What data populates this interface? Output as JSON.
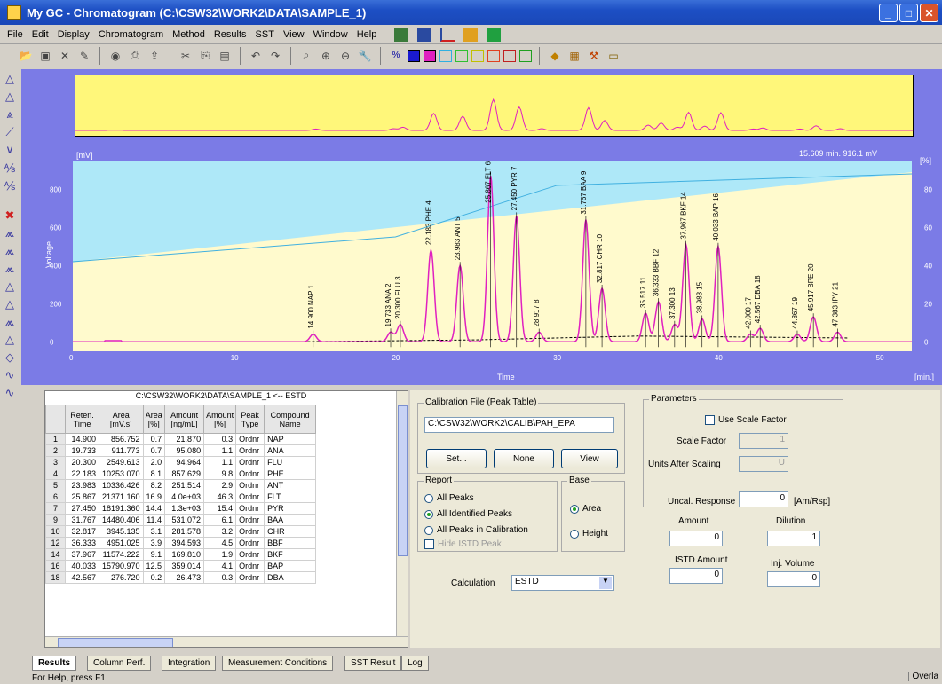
{
  "window": {
    "title": "My GC - Chromatogram (C:\\CSW32\\WORK2\\DATA\\SAMPLE_1)"
  },
  "menu": [
    "File",
    "Edit",
    "Display",
    "Chromatogram",
    "Method",
    "Results",
    "SST",
    "View",
    "Window",
    "Help"
  ],
  "chart": {
    "readout": "15.609 min. 916.1 mV",
    "y_label_units": "[mV]",
    "y_axis_title": "Voltage",
    "y_right_units": "[%]",
    "x_units": "[min.]",
    "x_title": "Time",
    "y_ticks": [
      "0",
      "200",
      "400",
      "600",
      "800"
    ],
    "y_right_ticks": [
      "0",
      "20",
      "40",
      "60",
      "80"
    ],
    "x_ticks": [
      "0",
      "10",
      "20",
      "30",
      "40",
      "50"
    ],
    "peak_labels": [
      {
        "text": "14.900 NAP 1",
        "t": 14.9
      },
      {
        "text": "19.733 ANA 2",
        "t": 19.7
      },
      {
        "text": "20.300 FLU 3",
        "t": 20.3
      },
      {
        "text": "22.183 PHE 4",
        "t": 22.2
      },
      {
        "text": "23.983 ANT 5",
        "t": 24.0
      },
      {
        "text": "25.867 FLT 6",
        "t": 25.9
      },
      {
        "text": "27.450 PYR 7",
        "t": 27.5
      },
      {
        "text": "28.917 8",
        "t": 28.9
      },
      {
        "text": "31.767 BAA 9",
        "t": 31.8
      },
      {
        "text": "32.817 CHR 10",
        "t": 32.8
      },
      {
        "text": "35.517 11",
        "t": 35.5
      },
      {
        "text": "36.333 BBF 12",
        "t": 36.3
      },
      {
        "text": "37.300 13",
        "t": 37.3
      },
      {
        "text": "37.967 BKF 14",
        "t": 38.0
      },
      {
        "text": "38.983 15",
        "t": 39.0
      },
      {
        "text": "40.033 BAP 16",
        "t": 40.0
      },
      {
        "text": "42.000 17",
        "t": 42.0
      },
      {
        "text": "42.567 DBA 18",
        "t": 42.6
      },
      {
        "text": "44.867 19",
        "t": 44.9
      },
      {
        "text": "45.917 BPE 20",
        "t": 45.9
      },
      {
        "text": "47.383 IPY 21",
        "t": 47.4
      }
    ]
  },
  "chart_data": {
    "type": "line",
    "xlabel": "Time",
    "ylabel": "Voltage",
    "xlim": [
      0,
      52
    ],
    "ylim": [
      -50,
      950
    ],
    "peaks": [
      {
        "t": 14.9,
        "h": 40
      },
      {
        "t": 19.7,
        "h": 50
      },
      {
        "t": 20.3,
        "h": 90
      },
      {
        "t": 22.2,
        "h": 480
      },
      {
        "t": 24.0,
        "h": 400
      },
      {
        "t": 25.9,
        "h": 870
      },
      {
        "t": 27.5,
        "h": 660
      },
      {
        "t": 28.9,
        "h": 50
      },
      {
        "t": 31.8,
        "h": 640
      },
      {
        "t": 32.8,
        "h": 280
      },
      {
        "t": 35.5,
        "h": 150
      },
      {
        "t": 36.3,
        "h": 210
      },
      {
        "t": 37.3,
        "h": 90
      },
      {
        "t": 38.0,
        "h": 510
      },
      {
        "t": 39.0,
        "h": 120
      },
      {
        "t": 40.0,
        "h": 500
      },
      {
        "t": 42.0,
        "h": 40
      },
      {
        "t": 42.6,
        "h": 70
      },
      {
        "t": 44.9,
        "h": 40
      },
      {
        "t": 45.9,
        "h": 130
      },
      {
        "t": 47.4,
        "h": 50
      }
    ]
  },
  "table": {
    "path": "C:\\CSW32\\WORK2\\DATA\\SAMPLE_1 <-- ESTD",
    "headers": [
      "",
      "Reten. Time",
      "Area [mV.s]",
      "Area [%]",
      "Amount [ng/mL]",
      "Amount [%]",
      "Peak Type",
      "Compound Name"
    ],
    "rows": [
      [
        "1",
        "14.900",
        "856.752",
        "0.7",
        "21.870",
        "0.3",
        "Ordnr",
        "NAP"
      ],
      [
        "2",
        "19.733",
        "911.773",
        "0.7",
        "95.080",
        "1.1",
        "Ordnr",
        "ANA"
      ],
      [
        "3",
        "20.300",
        "2549.613",
        "2.0",
        "94.964",
        "1.1",
        "Ordnr",
        "FLU"
      ],
      [
        "4",
        "22.183",
        "10253.070",
        "8.1",
        "857.629",
        "9.8",
        "Ordnr",
        "PHE"
      ],
      [
        "5",
        "23.983",
        "10336.426",
        "8.2",
        "251.514",
        "2.9",
        "Ordnr",
        "ANT"
      ],
      [
        "6",
        "25.867",
        "21371.160",
        "16.9",
        "4.0e+03",
        "46.3",
        "Ordnr",
        "FLT"
      ],
      [
        "7",
        "27.450",
        "18191.360",
        "14.4",
        "1.3e+03",
        "15.4",
        "Ordnr",
        "PYR"
      ],
      [
        "9",
        "31.767",
        "14480.406",
        "11.4",
        "531.072",
        "6.1",
        "Ordnr",
        "BAA"
      ],
      [
        "10",
        "32.817",
        "3945.135",
        "3.1",
        "281.578",
        "3.2",
        "Ordnr",
        "CHR"
      ],
      [
        "12",
        "36.333",
        "4951.025",
        "3.9",
        "394.593",
        "4.5",
        "Ordnr",
        "BBF"
      ],
      [
        "14",
        "37.967",
        "11574.222",
        "9.1",
        "169.810",
        "1.9",
        "Ordnr",
        "BKF"
      ],
      [
        "16",
        "40.033",
        "15790.970",
        "12.5",
        "359.014",
        "4.1",
        "Ordnr",
        "BAP"
      ],
      [
        "18",
        "42.567",
        "276.720",
        "0.2",
        "26.473",
        "0.3",
        "Ordnr",
        "DBA"
      ]
    ]
  },
  "calibration": {
    "group": "Calibration File (Peak Table)",
    "file": "C:\\CSW32\\WORK2\\CALIB\\PAH_EPA",
    "set": "Set...",
    "none": "None",
    "view": "View"
  },
  "report": {
    "group": "Report",
    "options": [
      "All Peaks",
      "All Identified Peaks",
      "All Peaks in Calibration"
    ],
    "hide_istd": "Hide ISTD Peak"
  },
  "base": {
    "group": "Base",
    "options": [
      "Area",
      "Height"
    ]
  },
  "calculation": {
    "label": "Calculation",
    "value": "ESTD"
  },
  "parameters": {
    "group": "Parameters",
    "use_scale": "Use Scale Factor",
    "scale_factor_label": "Scale Factor",
    "scale_factor_value": "1",
    "units_label": "Units After Scaling",
    "units_value": "U",
    "uncal_label": "Uncal. Response",
    "uncal_value": "0",
    "uncal_units": "[Am/Rsp]",
    "amount_label": "Amount",
    "amount_value": "0",
    "dilution_label": "Dilution",
    "dilution_value": "1",
    "istd_label": "ISTD Amount",
    "istd_value": "0",
    "inj_label": "Inj. Volume",
    "inj_value": "0"
  },
  "tabs": [
    "Results",
    "Column Perf.",
    "Integration",
    "Measurement Conditions",
    "SST Result",
    "Log"
  ],
  "status": {
    "help": "For Help, press F1",
    "mode": "Overla"
  }
}
